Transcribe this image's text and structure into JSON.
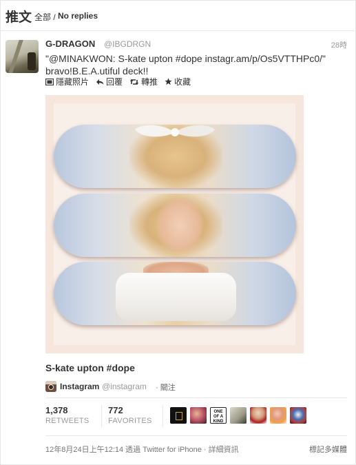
{
  "header": {
    "title": "推文",
    "crumb_all": "全部 /",
    "crumb_current": "No replies"
  },
  "tweet": {
    "name": "G-DRAGON",
    "handle": "@IBGDRGN",
    "time": "28時",
    "text_line1": "\"@MINAKWON: S-kate upton #dope instagr.am/p/Os5VTTHPc0/\"",
    "text_line2": "bravo!B.E.A.utiful deck!!"
  },
  "actions": {
    "hide_photo": "隱藏照片",
    "reply": "回覆",
    "retweet": "轉推",
    "favorite": "收藏"
  },
  "icons": {
    "hide_photo": "photo-icon",
    "reply": "reply-arrow-icon",
    "retweet": "retweet-icon",
    "favorite": "star-icon"
  },
  "card": {
    "title": "S-kate upton #dope",
    "source_name": "Instagram",
    "source_handle": "@instagram",
    "follow_label": "· 關注"
  },
  "stats": {
    "retweets_count": "1,378",
    "retweets_label": "RETWEETS",
    "favorites_count": "772",
    "favorites_label": "FAVORITES"
  },
  "favoriters_badge_text": "ONE OF A KIND",
  "footer": {
    "meta": "12年8月24日上午12:14 透過 Twitter for iPhone · 詳細資訊",
    "flag_media": "標記多媒體"
  },
  "colors": {
    "muted": "#999999",
    "text": "#333333",
    "divider": "#e8e8e8"
  }
}
